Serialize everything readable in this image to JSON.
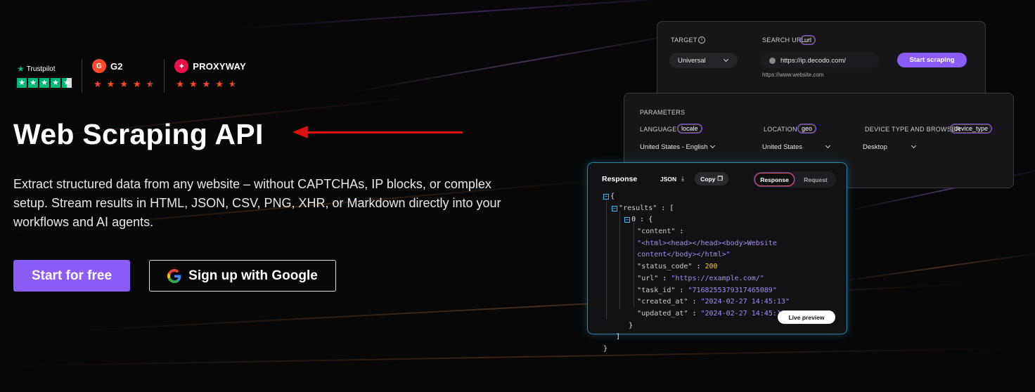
{
  "ratings": {
    "trustpilot": {
      "name": "Trustpilot",
      "stars": 4.5
    },
    "g2": {
      "name": "G2",
      "stars": 4.5
    },
    "proxyway": {
      "name": "PROXYWAY",
      "stars": 4.5
    }
  },
  "hero": {
    "title": "Web Scraping API",
    "description": "Extract structured data from any website – without CAPTCHAs, IP blocks, or complex setup. Stream results in HTML, JSON, CSV, PNG, XHR, or Markdown directly into your workflows and AI agents.",
    "primary_button": "Start for free",
    "google_button": "Sign up with Google"
  },
  "target_card": {
    "target_label": "TARGET",
    "target_value": "Universal",
    "search_url_label": "SEARCH URL",
    "search_url_chip": "url",
    "url_value": "https://ip.decodo.com/",
    "url_hint": "https://www.website.com",
    "start_button": "Start scraping"
  },
  "params_card": {
    "title": "PARAMETERS",
    "language_label": "LANGUAGE",
    "language_chip": "locale",
    "language_value": "United States - English",
    "location_label": "LOCATION",
    "location_chip": "geo",
    "location_value": "United States",
    "device_label": "DEVICE TYPE AND BROWSER",
    "device_chip": "device_type",
    "device_value": "Desktop"
  },
  "response_card": {
    "title": "Response",
    "format": "JSON",
    "copy_label": "Copy",
    "tab_response": "Response",
    "tab_request": "Request",
    "live_preview": "Live preview",
    "json": {
      "results_key": "\"results\"",
      "index": "0",
      "content_key": "\"content\"",
      "content_value_1": "\"<html><head></head><body>Website",
      "content_value_2": "content</body></html>\"",
      "status_code_key": "\"status_code\"",
      "status_code_value": "200",
      "url_key": "\"url\"",
      "url_value": "\"https://example.com/\"",
      "task_id_key": "\"task_id\"",
      "task_id_value": "\"7168255379317465089\"",
      "created_at_key": "\"created_at\"",
      "created_at_value": "\"2024-02-27 14:45:13\"",
      "updated_at_key": "\"updated_at\"",
      "updated_at_value": "\"2024-02-27 14:45:18\""
    }
  },
  "colors": {
    "accent": "#8b5cf6",
    "trustpilot_green": "#00b67a",
    "g2_red": "#ff492c",
    "arrow_red": "#e01010"
  }
}
